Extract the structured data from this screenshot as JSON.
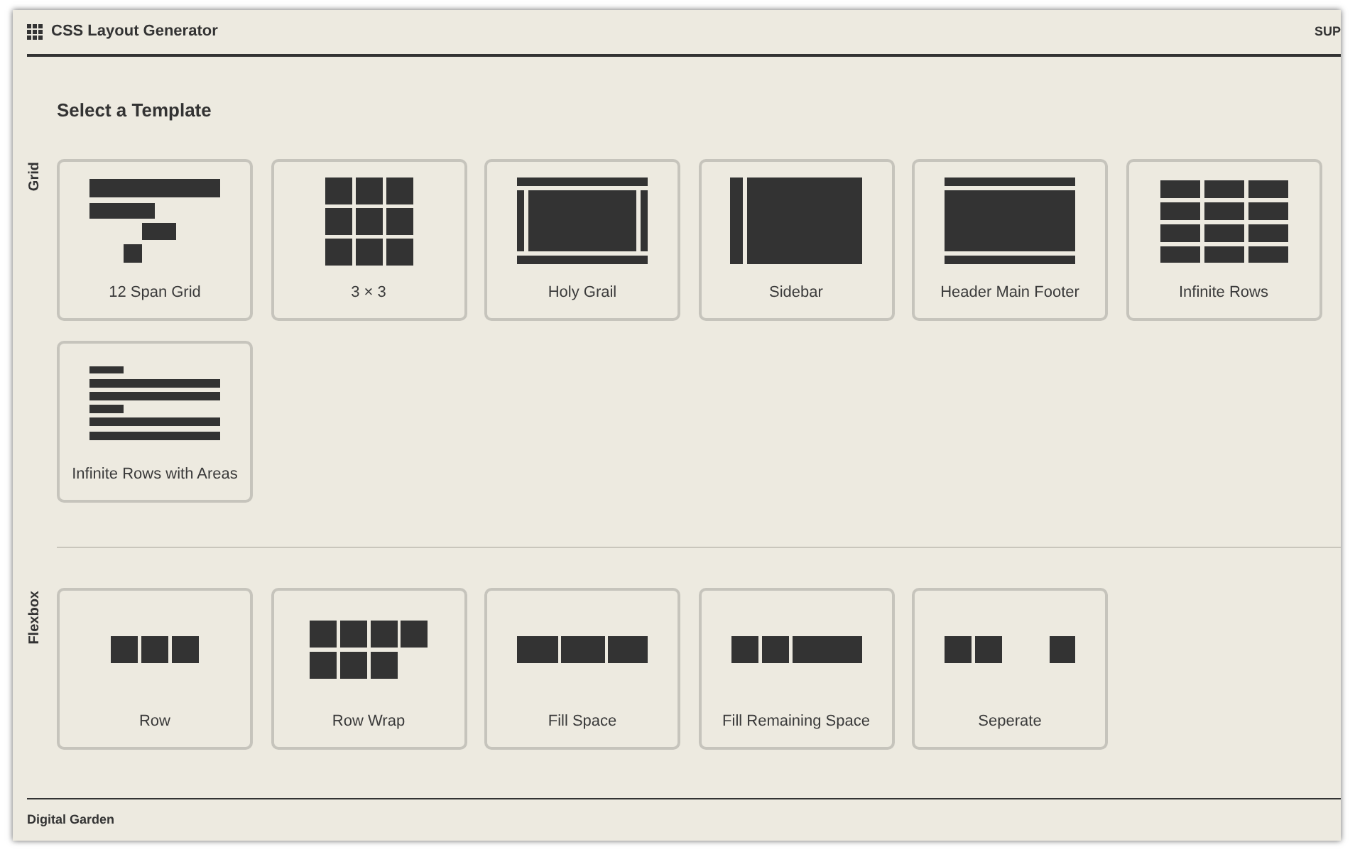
{
  "header": {
    "title": "CSS Layout Generator",
    "right_text": "SUP"
  },
  "heading": "Select a Template",
  "sections": [
    {
      "label": "Grid",
      "templates": [
        {
          "label": "12 Span Grid",
          "kind": "span"
        },
        {
          "label": "3 × 3",
          "kind": "three"
        },
        {
          "label": "Holy Grail",
          "kind": "grail"
        },
        {
          "label": "Sidebar",
          "kind": "sidebar"
        },
        {
          "label": "Header Main Footer",
          "kind": "hmf"
        },
        {
          "label": "Infinite Rows",
          "kind": "rows"
        },
        {
          "label": "Infinite Rows with Areas",
          "kind": "areas"
        }
      ]
    },
    {
      "label": "Flexbox",
      "templates": [
        {
          "label": "Row",
          "kind": "row"
        },
        {
          "label": "Row Wrap",
          "kind": "wrap"
        },
        {
          "label": "Fill Space",
          "kind": "fill"
        },
        {
          "label": "Fill Remaining Space",
          "kind": "remaining"
        },
        {
          "label": "Seperate",
          "kind": "separate"
        }
      ]
    }
  ],
  "footer": {
    "text": "Digital Garden"
  }
}
